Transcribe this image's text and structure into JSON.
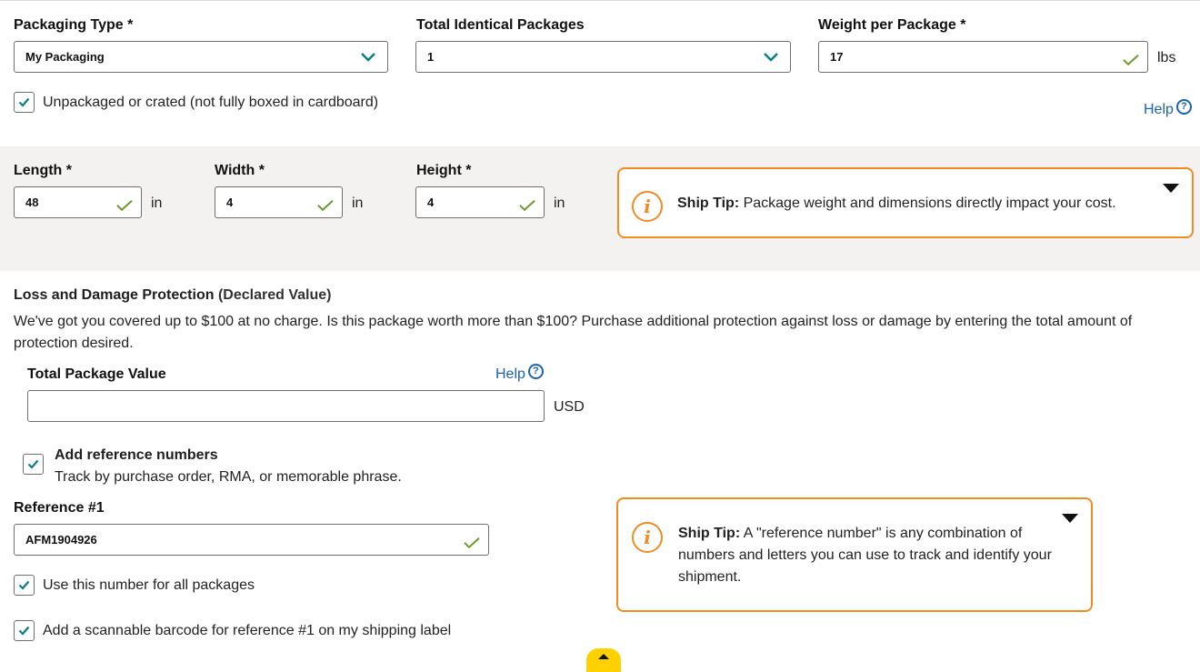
{
  "package": {
    "packaging_type": {
      "label": "Packaging Type *",
      "value": "My Packaging"
    },
    "total_identical": {
      "label": "Total Identical Packages",
      "value": "1"
    },
    "weight": {
      "label": "Weight per Package *",
      "value": "17",
      "unit": "lbs"
    },
    "unpackaged": {
      "label": "Unpackaged or crated (not fully boxed in cardboard)",
      "checked": true
    },
    "help_label": "Help"
  },
  "dimensions": {
    "length": {
      "label": "Length *",
      "value": "48",
      "unit": "in"
    },
    "width": {
      "label": "Width *",
      "value": "4",
      "unit": "in"
    },
    "height": {
      "label": "Height *",
      "value": "4",
      "unit": "in"
    },
    "tip": {
      "prefix": "Ship Tip:",
      "text": " Package weight and dimensions directly impact your cost."
    }
  },
  "protection": {
    "title": "Loss and Damage Protection",
    "title_suffix": " (Declared Value)",
    "description": "We've got you covered up to $100 at no charge. Is this package worth more than $100? Purchase additional protection against loss or damage by entering the total amount of protection desired.",
    "value_label": "Total Package Value",
    "help_label": "Help",
    "value": "",
    "currency": "USD"
  },
  "reference": {
    "add_label": "Add reference numbers",
    "add_sublabel": "Track by purchase order, RMA, or memorable phrase.",
    "ref1_label": "Reference #1",
    "ref1_value": "AFM1904926",
    "use_all_label": "Use this number for all packages",
    "barcode_label": "Add a scannable barcode for reference #1 on my shipping label",
    "tip": {
      "prefix": "Ship Tip:",
      "text": " A \"reference number\" is any combination of numbers and letters you can use to track and identify your shipment."
    }
  },
  "colors": {
    "accent_teal": "#0a8080",
    "check_green": "#6a9a2b",
    "tip_orange": "#f28b20",
    "link_blue": "#1c63ad",
    "band_gray": "#f3f2f1"
  }
}
